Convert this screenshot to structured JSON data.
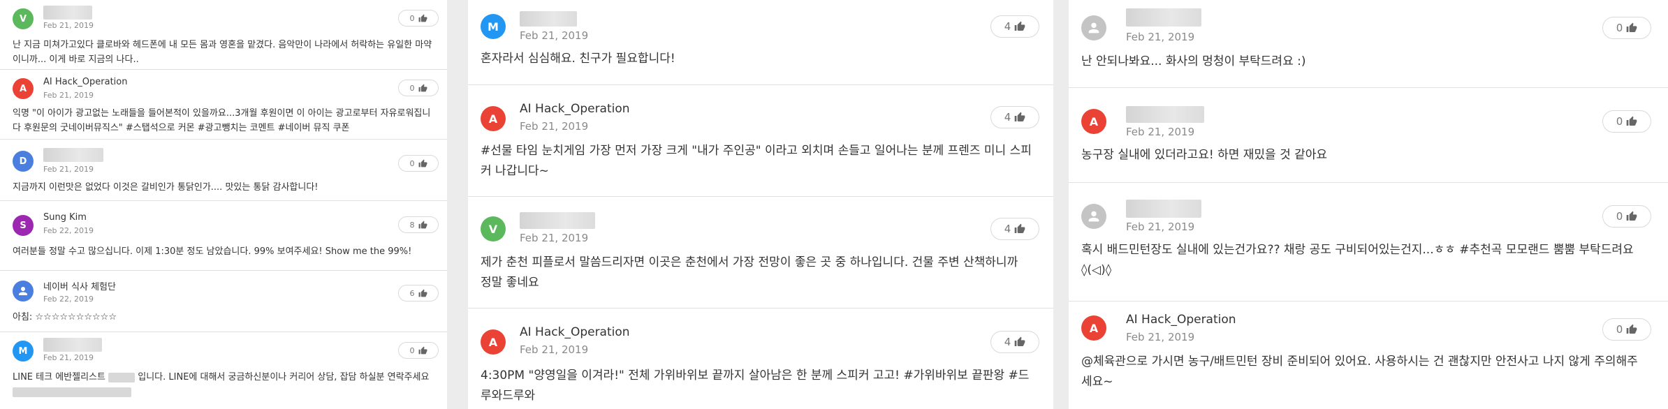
{
  "colors": {
    "green": "#5cb85c",
    "red": "#ea4335",
    "blue": "#2196f3",
    "royal": "#4a7fe0",
    "purple": "#9c27b0",
    "grey": "#c4c4c4",
    "star": "#e3b31b"
  },
  "icons": {
    "like": "thumbs-up-icon",
    "anonymous": "person-icon"
  },
  "column1": [
    {
      "initial": "V",
      "name": "",
      "date": "Feb 21, 2019",
      "likes": "0",
      "text": "난 지금 미쳐가고있다 클로바와 헤드폰에 내 모든 몸과 영혼을 맡겼다. 음악만이 나라에서 허락하는 유일한 마약이니까... 이게 바로 지금의 나다.."
    },
    {
      "initial": "A",
      "name": "AI Hack_Operation",
      "date": "Feb 21, 2019",
      "likes": "0",
      "text": "익명 \"이 아이가 광고없는 노래들을 들어본적이 있을까요...3개월 후원이면 이 아이는 광고로부터 자유로워집니다 후원문의 굿네이버뮤직스\" #스탭석으로 커몬 #광고뺑치는 코멘트 #네이버 뮤직 쿠폰"
    },
    {
      "initial": "D",
      "name": "",
      "date": "Feb 21, 2019",
      "likes": "0",
      "text": "지금까지 이런맛은 없었다 이것은 갈비인가 통닭인가.... 맛있는 통닭 감사합니다!"
    },
    {
      "initial": "S",
      "name": "Sung Kim",
      "date": "Feb 22, 2019",
      "likes": "8",
      "text": "여러분들 정말 수고 많으십니다. 이제 1:30분 정도 남았습니다. 99% 보여주세요! Show me the 99%!"
    },
    {
      "initial": "",
      "name": "네이버 식사 체험단",
      "date": "Feb 22, 2019",
      "likes": "6",
      "text": "아침: ☆☆☆☆☆☆☆☆☆☆"
    },
    {
      "initial": "M",
      "name": "",
      "date": "Feb 21, 2019",
      "likes": "0",
      "text_a": "LINE 테크 에반젤리스트",
      "text_b": "입니다. LINE에 대해서 궁금하신분이나 커리어 상담, 잡담 하실분 연락주세요"
    }
  ],
  "column2": [
    {
      "initial": "M",
      "name": "",
      "date": "Feb 21, 2019",
      "likes": "4",
      "text": "혼자라서 심심해요. 친구가 필요합니다!"
    },
    {
      "initial": "A",
      "name": "AI Hack_Operation",
      "date": "Feb 21, 2019",
      "likes": "4",
      "text": "#선물 타임 눈치게임 가장 먼저 가장 크게 \"내가 주인공\" 이라고 외치며 손들고 일어나는 분께 프렌즈 미니 스피커 나갑니다~"
    },
    {
      "initial": "V",
      "name": "",
      "date": "Feb 21, 2019",
      "likes": "4",
      "text": "제가 춘천 피플로서 말씀드리자면 이곳은 춘천에서 가장 전망이 좋은 곳 중 하나입니다. 건물 주변 산책하니까 정말 좋네요"
    },
    {
      "initial": "A",
      "name": "AI Hack_Operation",
      "date": "Feb 21, 2019",
      "likes": "4",
      "text": "4:30PM \"양영일을 이겨라!\" 전체 가위바위보 끝까지 살아남은 한 분께 스피커 고고! #가위바위보 끝판왕 #드루와드루와"
    }
  ],
  "column3": [
    {
      "initial": "",
      "name": "",
      "date": "Feb 21, 2019",
      "likes": "0",
      "text": "난 안되나봐요... 화사의 멍청이 부탁드려요 :)"
    },
    {
      "initial": "A",
      "name": "",
      "date": "Feb 21, 2019",
      "likes": "0",
      "text": "농구장 실내에 있더라고요! 하면 재밌을 것 같아요"
    },
    {
      "initial": "",
      "name": "",
      "date": "Feb 21, 2019",
      "likes": "0",
      "text": "혹시 배드민턴장도 실내에 있는건가요?? 채랑 공도 구비되어있는건지...ㅎㅎ #추천곡 모모랜드 뿜뿜 부탁드려요 ◊(◁)◊"
    },
    {
      "initial": "A",
      "name": "AI Hack_Operation",
      "date": "Feb 21, 2019",
      "likes": "0",
      "text": "@체육관으로 가시면 농구/배트민턴 장비 준비되어 있어요. 사용하시는 건 괜찮지만 안전사고 나지 않게 주의해주세요~"
    }
  ]
}
